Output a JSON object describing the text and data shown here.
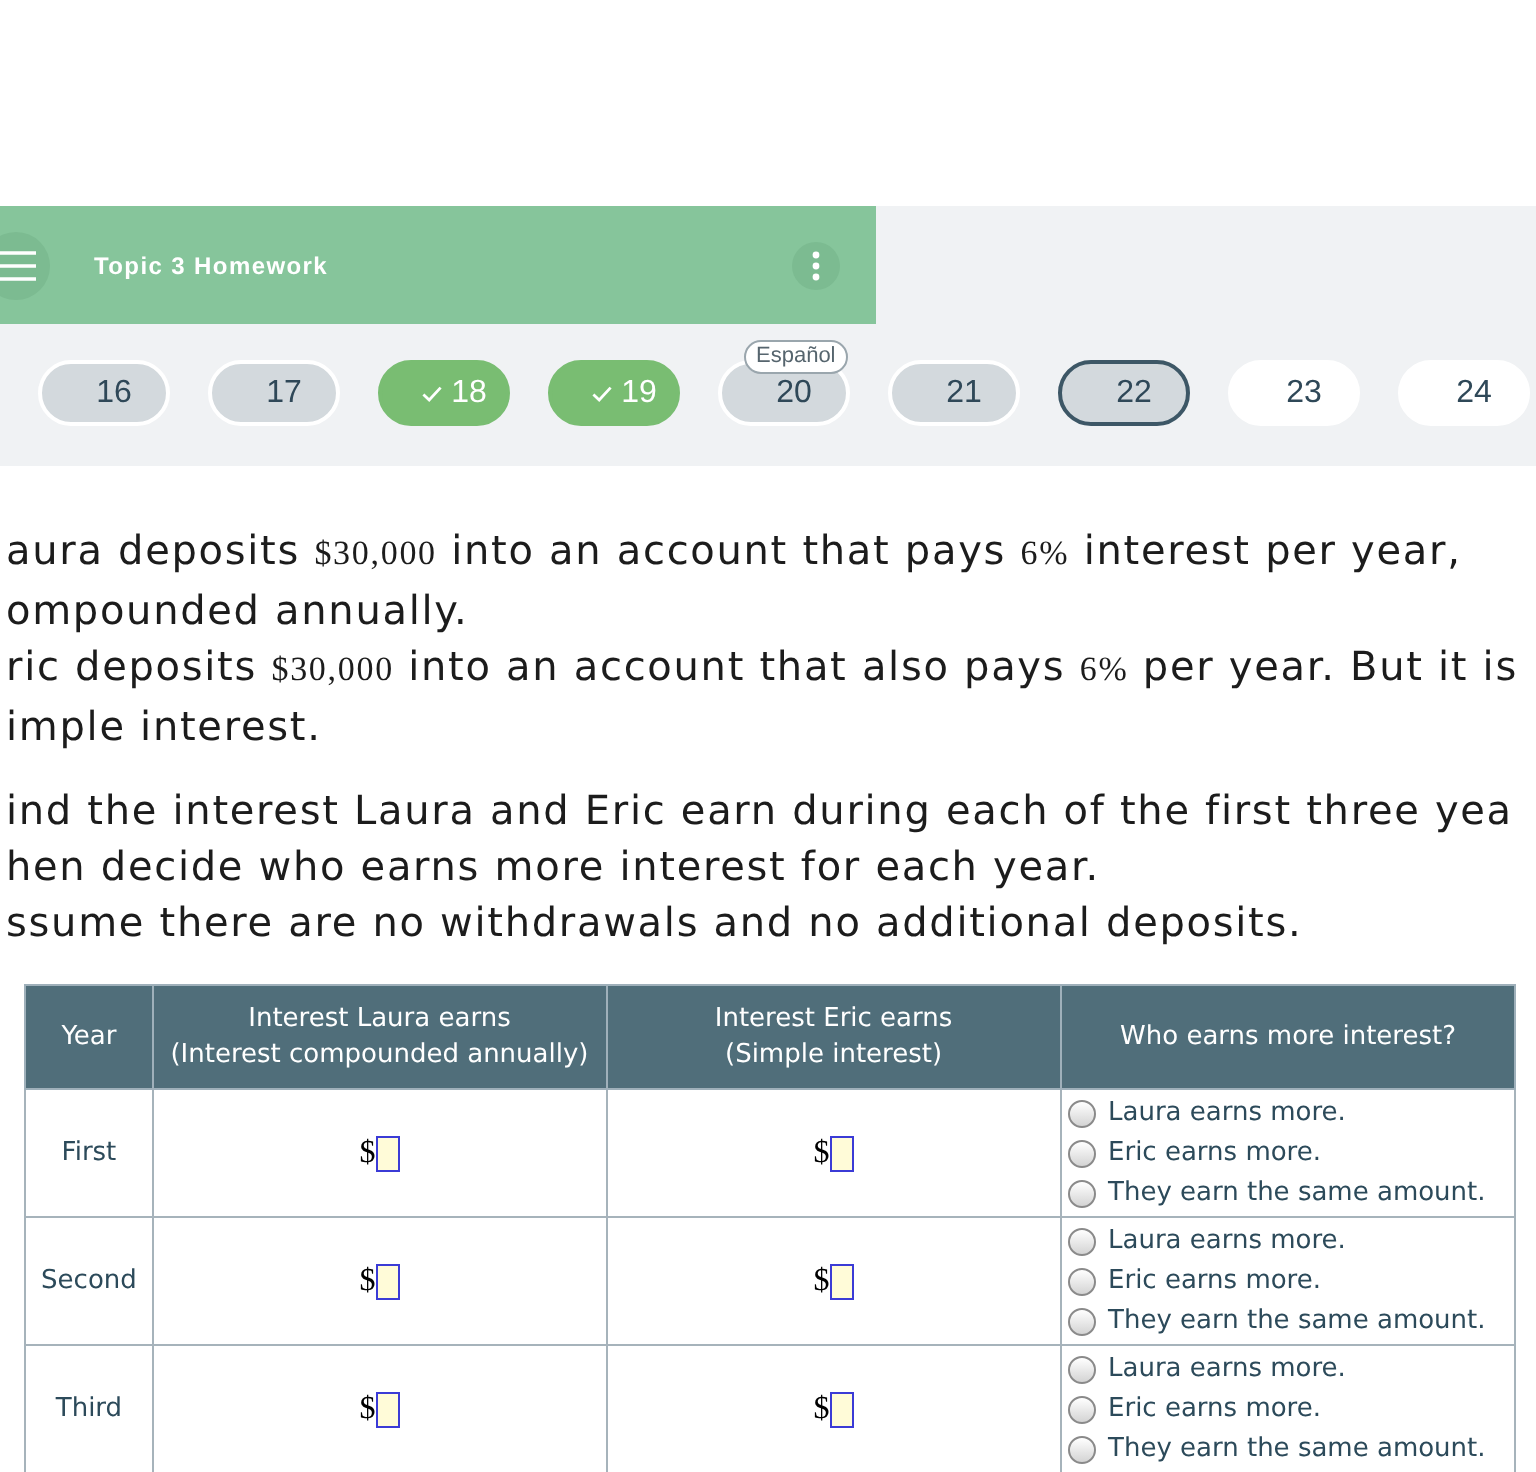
{
  "header": {
    "title": "Topic 3 Homework"
  },
  "questions": [
    {
      "label": "16",
      "kind": "visited",
      "selected": false
    },
    {
      "label": "17",
      "kind": "visited",
      "selected": false
    },
    {
      "label": "18",
      "kind": "complete",
      "selected": false
    },
    {
      "label": "19",
      "kind": "complete",
      "selected": false
    },
    {
      "label": "20",
      "kind": "visited",
      "selected": false,
      "badge": "Español"
    },
    {
      "label": "21",
      "kind": "visited",
      "selected": false
    },
    {
      "label": "22",
      "kind": "visited",
      "selected": true
    },
    {
      "label": "23",
      "kind": "unvisited",
      "selected": false
    },
    {
      "label": "24",
      "kind": "unvisited",
      "selected": false
    }
  ],
  "problem": {
    "paragraphs": [
      {
        "lines": [
          [
            {
              "kind": "text",
              "text": "aura deposits "
            },
            {
              "kind": "math",
              "text": "$30,000"
            },
            {
              "kind": "text",
              "text": " into an account that pays "
            },
            {
              "kind": "math",
              "text": "6%"
            },
            {
              "kind": "text",
              "text": " interest per year,"
            }
          ],
          [
            {
              "kind": "text",
              "text": "ompounded annually."
            }
          ],
          [
            {
              "kind": "text",
              "text": "ric deposits "
            },
            {
              "kind": "math",
              "text": "$30,000"
            },
            {
              "kind": "text",
              "text": " into an account that also pays "
            },
            {
              "kind": "math",
              "text": "6%"
            },
            {
              "kind": "text",
              "text": " per year. But it is"
            }
          ],
          [
            {
              "kind": "text",
              "text": "imple interest."
            }
          ]
        ]
      },
      {
        "lines": [
          [
            {
              "kind": "text",
              "text": "ind the interest Laura and Eric earn during each of the first three yea"
            }
          ],
          [
            {
              "kind": "text",
              "text": "hen decide who earns more interest for each year."
            }
          ],
          [
            {
              "kind": "text",
              "text": "ssume there are no withdrawals and no additional deposits."
            }
          ]
        ]
      }
    ]
  },
  "table": {
    "columns": [
      {
        "lines": [
          "Year"
        ]
      },
      {
        "lines": [
          "Interest Laura earns",
          "(Interest compounded annually)"
        ]
      },
      {
        "lines": [
          "Interest Eric earns",
          "(Simple interest)"
        ]
      },
      {
        "lines": [
          "Who earns more interest?"
        ]
      }
    ],
    "rows": [
      {
        "year": "First",
        "laura_answer": {
          "prefix": "$"
        },
        "eric_answer": {
          "prefix": "$"
        },
        "options": [
          {
            "label": "Laura earns more.",
            "selected": false
          },
          {
            "label": "Eric earns more.",
            "selected": false
          },
          {
            "label": "They earn the same amount.",
            "selected": false
          }
        ]
      },
      {
        "year": "Second",
        "laura_answer": {
          "prefix": "$"
        },
        "eric_answer": {
          "prefix": "$"
        },
        "options": [
          {
            "label": "Laura earns more.",
            "selected": false
          },
          {
            "label": "Eric earns more.",
            "selected": false
          },
          {
            "label": "They earn the same amount.",
            "selected": false
          }
        ]
      },
      {
        "year": "Third",
        "laura_answer": {
          "prefix": "$"
        },
        "eric_answer": {
          "prefix": "$"
        },
        "options": [
          {
            "label": "Laura earns more.",
            "selected": false
          },
          {
            "label": "Eric earns more.",
            "selected": false
          },
          {
            "label": "They earn the same amount.",
            "selected": false
          }
        ]
      }
    ]
  }
}
